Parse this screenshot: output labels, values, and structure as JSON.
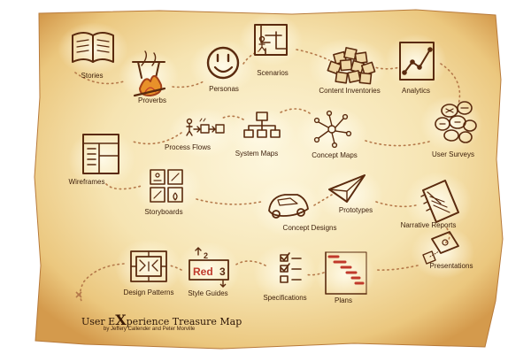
{
  "map": {
    "title_prefix": "User E",
    "title_big_letter": "X",
    "title_suffix": "perience Treasure Map",
    "credit": "by Jeffery Callender and Peter Morville"
  },
  "nodes": [
    {
      "id": "stories",
      "label": "Stories",
      "icon": "open-book-icon"
    },
    {
      "id": "proverbs",
      "label": "Proverbs",
      "icon": "campfire-cauldron-icon"
    },
    {
      "id": "personas",
      "label": "Personas",
      "icon": "smiley-face-icon"
    },
    {
      "id": "scenarios",
      "label": "Scenarios",
      "icon": "maze-figure-icon"
    },
    {
      "id": "content-inventories",
      "label": "Content Inventories",
      "icon": "sticky-notes-pile-icon"
    },
    {
      "id": "analytics",
      "label": "Analytics",
      "icon": "line-chart-icon"
    },
    {
      "id": "process-flows",
      "label": "Process Flows",
      "icon": "flow-steps-icon"
    },
    {
      "id": "system-maps",
      "label": "System Maps",
      "icon": "hierarchy-tree-icon"
    },
    {
      "id": "concept-maps",
      "label": "Concept Maps",
      "icon": "network-nodes-icon"
    },
    {
      "id": "user-surveys",
      "label": "User Surveys",
      "icon": "survey-bubbles-icon"
    },
    {
      "id": "wireframes",
      "label": "Wireframes",
      "icon": "wireframe-layout-icon"
    },
    {
      "id": "storyboards",
      "label": "Storyboards",
      "icon": "storyboard-panels-icon"
    },
    {
      "id": "concept-designs",
      "label": "Concept Designs",
      "icon": "car-sketch-icon"
    },
    {
      "id": "prototypes",
      "label": "Prototypes",
      "icon": "paper-plane-icon"
    },
    {
      "id": "narrative-reports",
      "label": "Narrative Reports",
      "icon": "notebook-icon"
    },
    {
      "id": "design-patterns",
      "label": "Design Patterns",
      "icon": "pattern-tiles-icon"
    },
    {
      "id": "style-guides",
      "label": "Style Guides",
      "icon": "red-style-card-icon"
    },
    {
      "id": "specifications",
      "label": "Specifications",
      "icon": "checklist-icon"
    },
    {
      "id": "plans",
      "label": "Plans",
      "icon": "gantt-chart-icon"
    },
    {
      "id": "presentations",
      "label": "Presentations",
      "icon": "projector-screen-icon"
    }
  ],
  "style_guide_text": {
    "numeral_top": "2",
    "word": "Red",
    "numeral_side": "3"
  },
  "colors": {
    "parchment": "#f4e2b4",
    "ink": "#5a2a0e",
    "path": "#b5794a",
    "title": "#2e1606",
    "accent_red": "#c0392b"
  }
}
